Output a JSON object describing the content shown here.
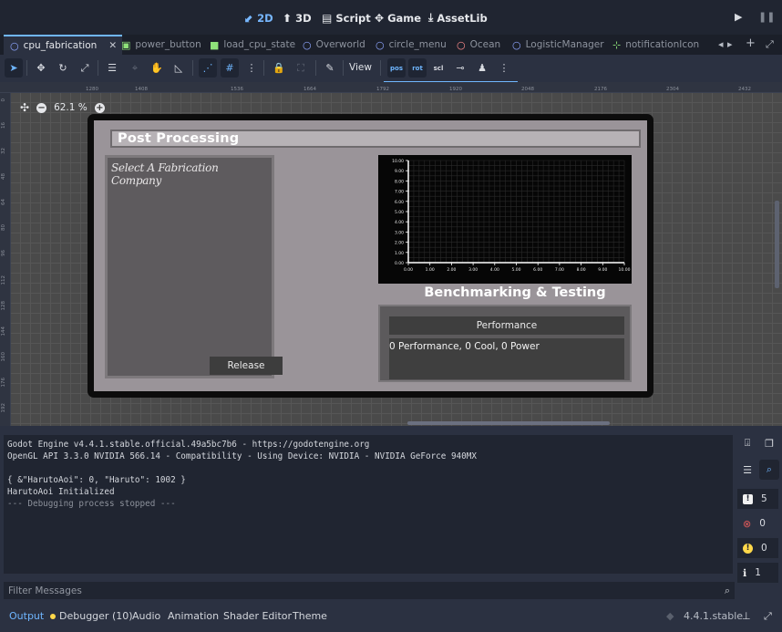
{
  "workspaces": [
    {
      "label": "2D",
      "icon": "2d-icon",
      "active": true
    },
    {
      "label": "3D",
      "icon": "3d-icon",
      "active": false
    },
    {
      "label": "Script",
      "icon": "script-icon",
      "active": false
    },
    {
      "label": "Game",
      "icon": "game-icon",
      "active": false
    },
    {
      "label": "AssetLib",
      "icon": "assetlib-icon",
      "active": false
    }
  ],
  "scene_tabs": [
    {
      "label": "cpu_fabrication",
      "icon": "node-icon",
      "active": true
    },
    {
      "label": "power_button",
      "icon": "image-icon",
      "active": false
    },
    {
      "label": "load_cpu_state",
      "icon": "control-icon",
      "active": false
    },
    {
      "label": "Overworld",
      "icon": "node-icon",
      "active": false
    },
    {
      "label": "circle_menu",
      "icon": "node-icon",
      "active": false
    },
    {
      "label": "Ocean",
      "icon": "node-icon",
      "active": false
    },
    {
      "label": "LogisticManager",
      "icon": "node-icon",
      "active": false
    },
    {
      "label": "notificationIcon",
      "icon": "icon-icon",
      "active": false
    }
  ],
  "toolbar": {
    "view_label": "View",
    "snap_labels": [
      "pos",
      "rot",
      "scl"
    ]
  },
  "viewport": {
    "zoom": "62.1 %",
    "ruler_top": [
      "1280",
      "1408",
      "1536",
      "1664",
      "1792",
      "1920",
      "2048",
      "2176",
      "2304",
      "2432"
    ],
    "ruler_left": [
      "0",
      "16",
      "32",
      "48",
      "64",
      "80",
      "96",
      "112",
      "128",
      "144",
      "160",
      "176",
      "192"
    ]
  },
  "scene": {
    "title": "Post Processing",
    "company_heading": "Select A Fabrication Company",
    "release_label": "Release",
    "benchmark_title": "Benchmarking & Testing",
    "performance_label": "Performance",
    "performance_output": "0 Performance, 0 Cool, 0 Power"
  },
  "chart_data": {
    "type": "line",
    "title": "",
    "xlabel": "",
    "ylabel": "",
    "xlim": [
      0,
      10
    ],
    "ylim": [
      0,
      10
    ],
    "x_ticks": [
      "0.00",
      "1.00",
      "2.00",
      "3.00",
      "4.00",
      "5.00",
      "6.00",
      "7.00",
      "8.00",
      "9.00",
      "10.00"
    ],
    "y_ticks": [
      "0.00",
      "1.00",
      "2.00",
      "3.00",
      "4.00",
      "5.00",
      "6.00",
      "7.00",
      "8.00",
      "9.00",
      "10.00"
    ],
    "grid": true,
    "series": []
  },
  "output_log": {
    "lines": [
      "Godot Engine v4.4.1.stable.official.49a5bc7b6 - https://godotengine.org",
      "OpenGL API 3.3.0 NVIDIA 566.14 - Compatibility - Using Device: NVIDIA - NVIDIA GeForce 940MX",
      "",
      "{ &\"HarutoAoi\": 0, \"Haruto\": 1002 }",
      "HarutoAoi Initialized",
      "--- Debugging process stopped ---"
    ],
    "filter_placeholder": "Filter Messages"
  },
  "message_counts": {
    "errors": "5",
    "warnings_err": "0",
    "warnings": "0",
    "info": "1"
  },
  "bottom_tabs": [
    "Output",
    "Debugger (10)",
    "Audio",
    "Animation",
    "Shader Editor",
    "Theme"
  ],
  "version": "4.4.1.stable",
  "colors": {
    "accent": "#70b7ff",
    "editor_bg": "#202531",
    "panel_bg": "#2b3141",
    "error": "#e05a5a",
    "warning": "#ffd84a"
  }
}
